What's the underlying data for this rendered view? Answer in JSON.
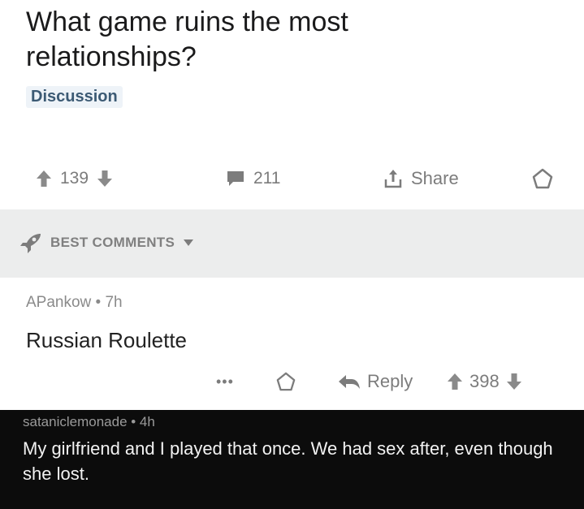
{
  "post": {
    "title": "What game ruins the most relationships?",
    "flair": "Discussion",
    "score": "139",
    "comments": "211",
    "share_label": "Share"
  },
  "comments_header": {
    "label": "BEST COMMENTS"
  },
  "top_comment": {
    "author": "APankow",
    "age": "7h",
    "meta": "APankow • 7h",
    "body": "Russian Roulette",
    "more": "•••",
    "reply_label": "Reply",
    "score": "398"
  },
  "reply_comment": {
    "author": "sataniclemonade",
    "age": "4h",
    "meta": "sataniclemonade • 4h",
    "body": "My girlfriend and I played that once. We had sex after, even though she lost."
  },
  "colors": {
    "text": "#1a1a1b",
    "muted": "#7c7c7c",
    "flair": "#3c5a74",
    "band": "#eceded",
    "dark": "#0c0c0c"
  },
  "icons": [
    "upvote-icon",
    "downvote-icon",
    "comment-icon",
    "share-icon",
    "save-icon",
    "rocket-icon",
    "caret-down-icon",
    "reply-icon"
  ]
}
